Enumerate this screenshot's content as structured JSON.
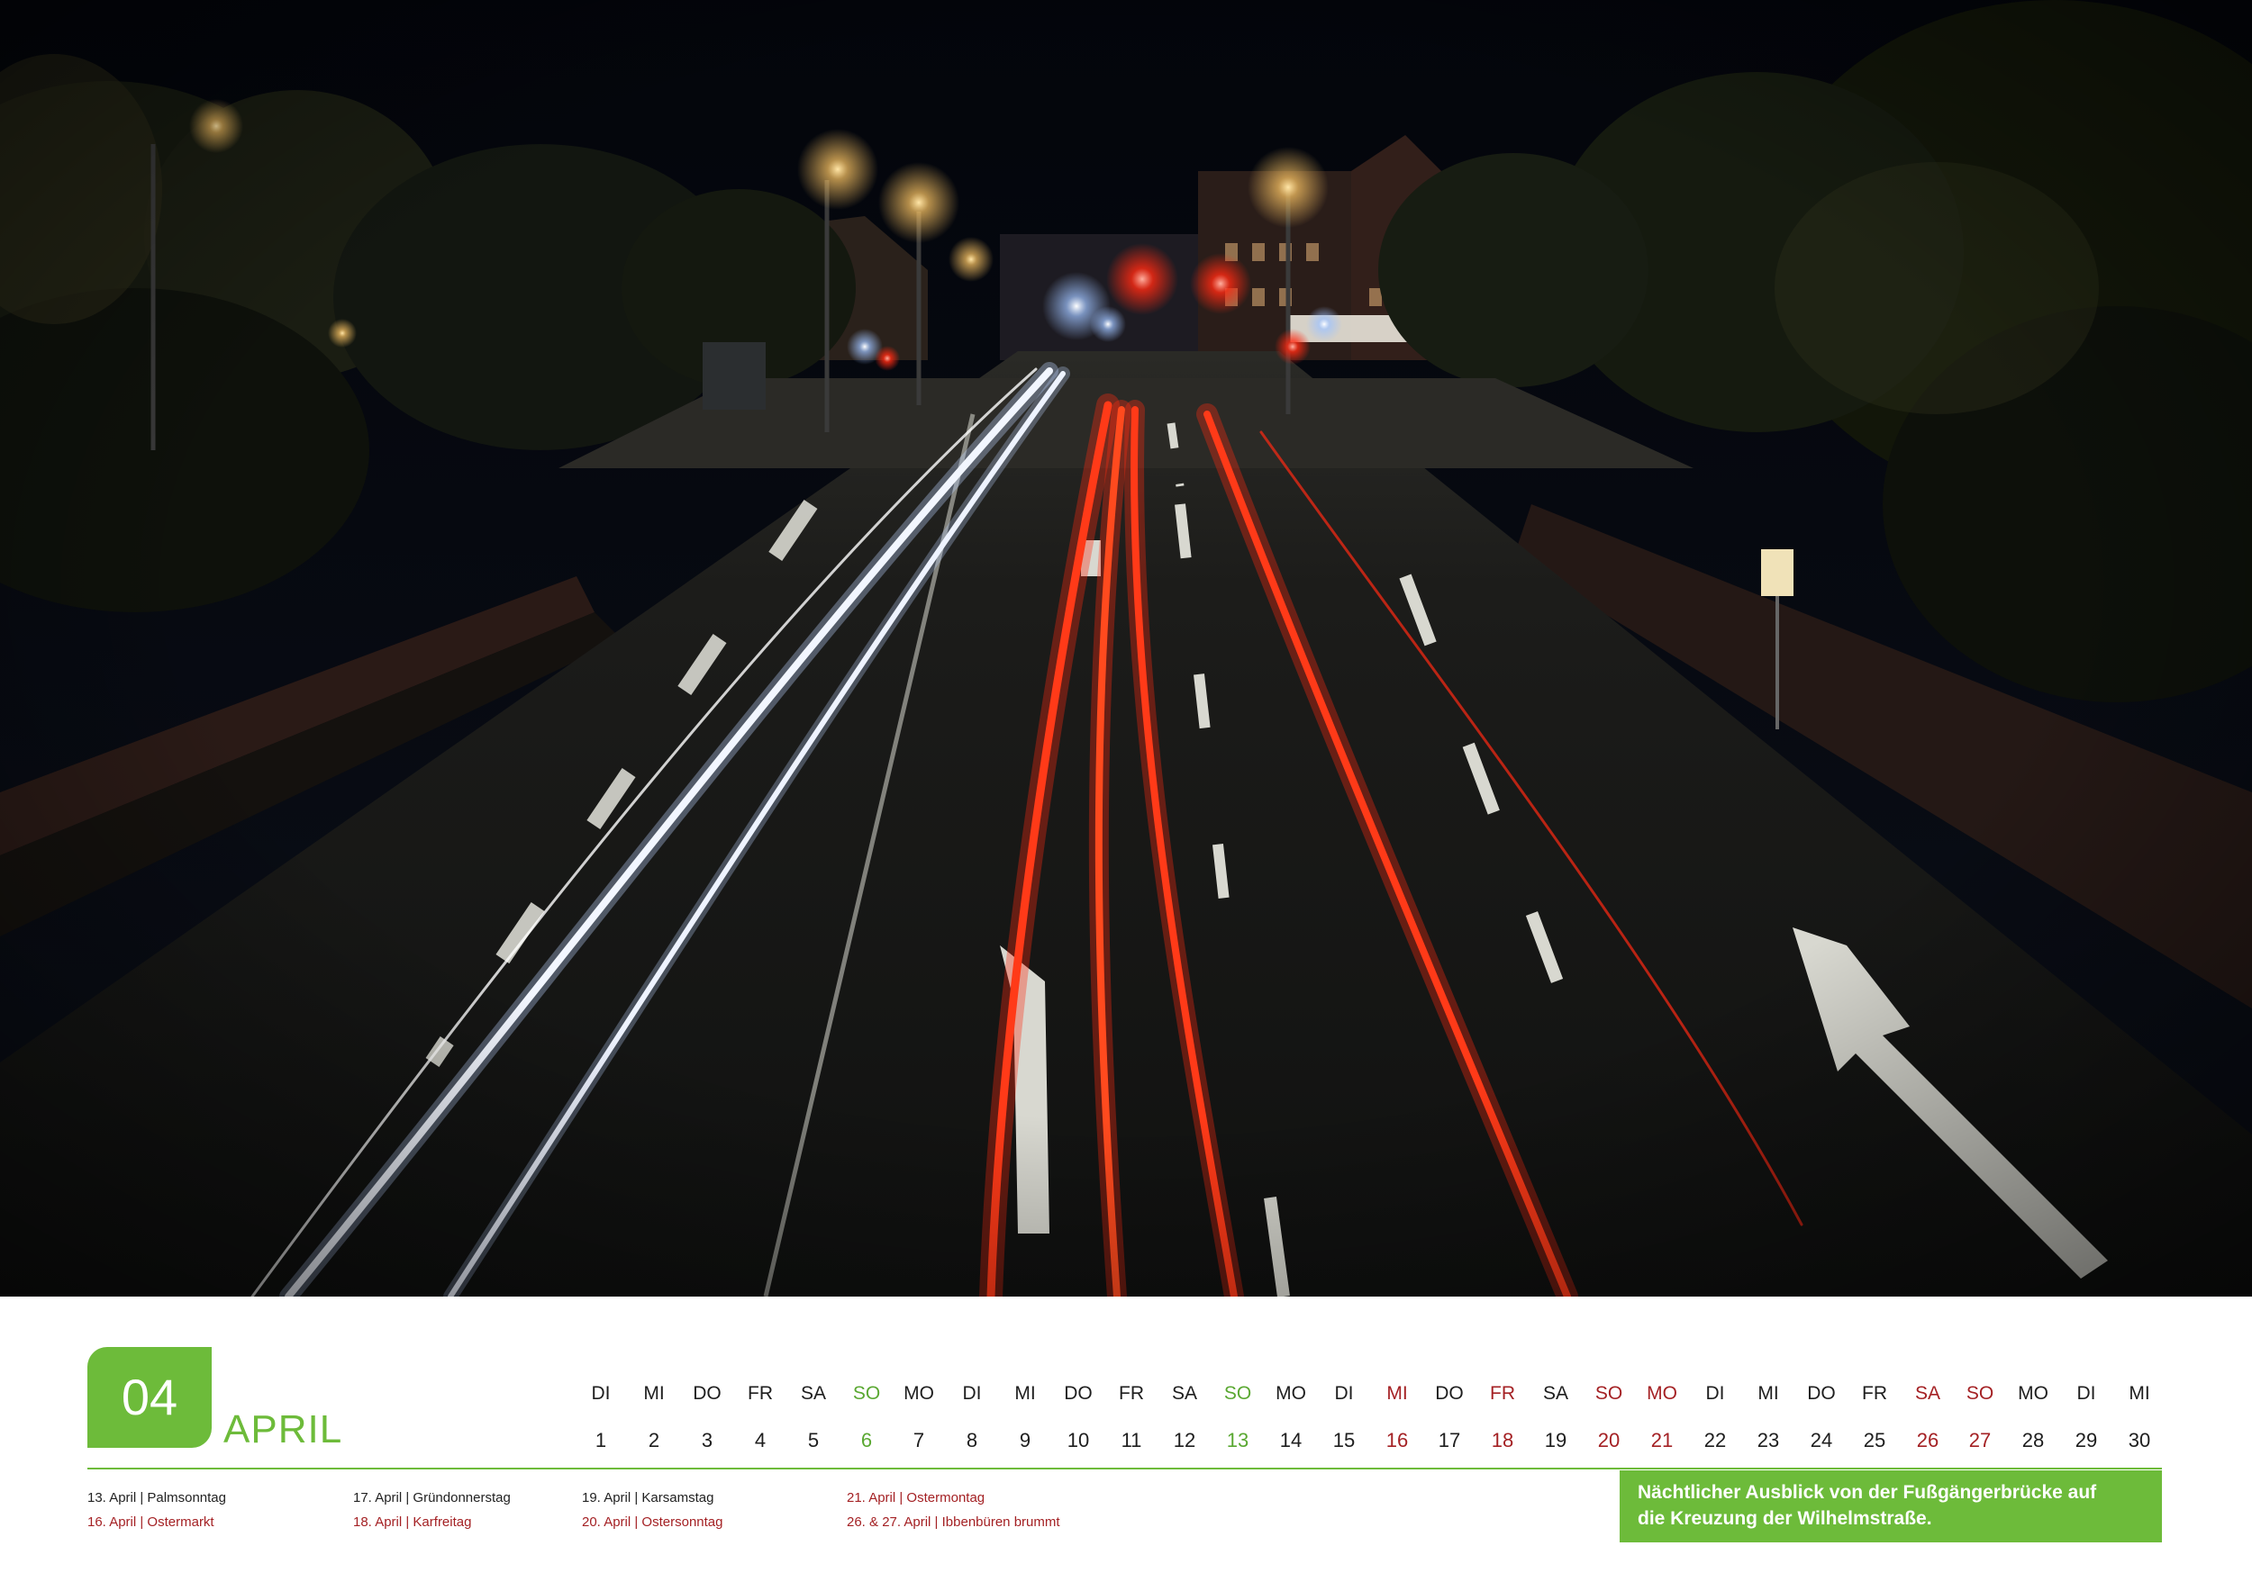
{
  "photo": {
    "subject": "Long-exposure night photo of a multi-lane road with white and red light trails leading to an illuminated junction",
    "accent_colors": {
      "headlight_trail": "#f2f6ff",
      "taillight_trail": "#ff2a12",
      "streetlight": "#ffc765"
    }
  },
  "calendar": {
    "month_number": "04",
    "month_name": "APRIL",
    "colors": {
      "accent_green": "#6dbb3a",
      "sunday_green": "#5aa832",
      "holiday_red": "#a42124",
      "text": "#1e1e1e"
    },
    "days": [
      {
        "wd": "DI",
        "num": "1",
        "type": "normal"
      },
      {
        "wd": "MI",
        "num": "2",
        "type": "normal"
      },
      {
        "wd": "DO",
        "num": "3",
        "type": "normal"
      },
      {
        "wd": "FR",
        "num": "4",
        "type": "normal"
      },
      {
        "wd": "SA",
        "num": "5",
        "type": "normal"
      },
      {
        "wd": "SO",
        "num": "6",
        "type": "sunday"
      },
      {
        "wd": "MO",
        "num": "7",
        "type": "normal"
      },
      {
        "wd": "DI",
        "num": "8",
        "type": "normal"
      },
      {
        "wd": "MI",
        "num": "9",
        "type": "normal"
      },
      {
        "wd": "DO",
        "num": "10",
        "type": "normal"
      },
      {
        "wd": "FR",
        "num": "11",
        "type": "normal"
      },
      {
        "wd": "SA",
        "num": "12",
        "type": "normal"
      },
      {
        "wd": "SO",
        "num": "13",
        "type": "sunday"
      },
      {
        "wd": "MO",
        "num": "14",
        "type": "normal"
      },
      {
        "wd": "DI",
        "num": "15",
        "type": "normal"
      },
      {
        "wd": "MI",
        "num": "16",
        "type": "holiday"
      },
      {
        "wd": "DO",
        "num": "17",
        "type": "normal"
      },
      {
        "wd": "FR",
        "num": "18",
        "type": "holiday"
      },
      {
        "wd": "SA",
        "num": "19",
        "type": "normal"
      },
      {
        "wd": "SO",
        "num": "20",
        "type": "holiday"
      },
      {
        "wd": "MO",
        "num": "21",
        "type": "holiday"
      },
      {
        "wd": "DI",
        "num": "22",
        "type": "normal"
      },
      {
        "wd": "MI",
        "num": "23",
        "type": "normal"
      },
      {
        "wd": "DO",
        "num": "24",
        "type": "normal"
      },
      {
        "wd": "FR",
        "num": "25",
        "type": "normal"
      },
      {
        "wd": "SA",
        "num": "26",
        "type": "holiday"
      },
      {
        "wd": "SO",
        "num": "27",
        "type": "holiday"
      },
      {
        "wd": "MO",
        "num": "28",
        "type": "normal"
      },
      {
        "wd": "DI",
        "num": "29",
        "type": "normal"
      },
      {
        "wd": "MI",
        "num": "30",
        "type": "normal"
      }
    ],
    "events": [
      {
        "top": "13. April | Palmsonntag",
        "bottom": "16. April | Ostermarkt"
      },
      {
        "top": "17. April | Gründonnerstag",
        "bottom": "18. April | Karfreitag"
      },
      {
        "top": "19. April | Karsamstag",
        "bottom": "20. April | Ostersonntag"
      },
      {
        "top": "21. April | Ostermontag",
        "bottom": "26. & 27. April | Ibbenbüren brummt"
      }
    ],
    "caption": {
      "line1": "Nächtlicher Ausblick von der Fußgängerbrücke auf",
      "line2": "die Kreuzung der Wilhelmstraße."
    }
  }
}
